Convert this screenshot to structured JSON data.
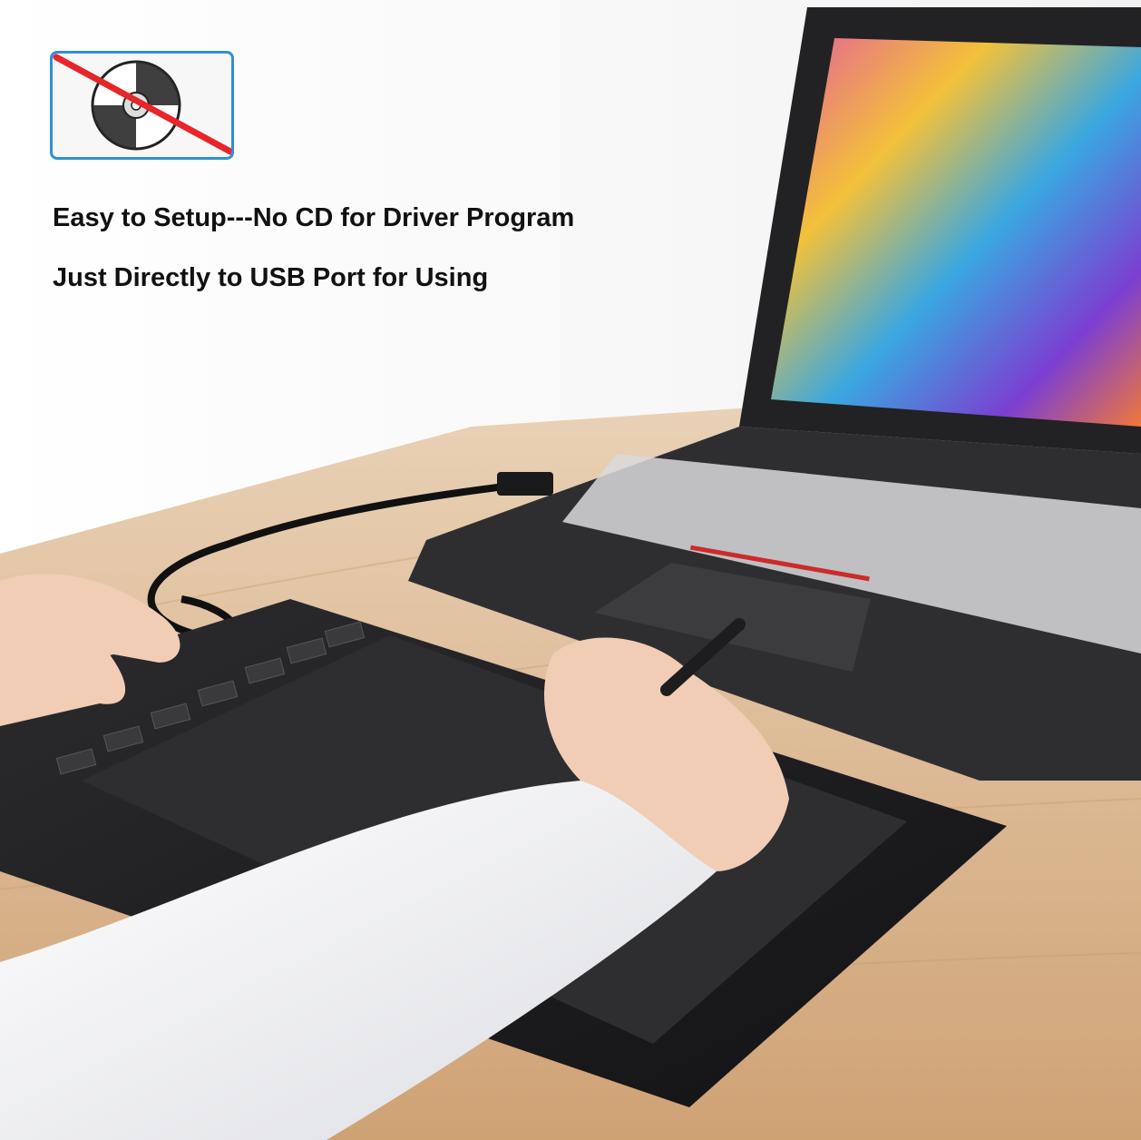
{
  "headline": {
    "line1": "Easy to Setup---No CD for Driver Program",
    "line2": "Just Directly to USB Port for Using"
  },
  "badge": {
    "icon": "no-cd-icon",
    "border_color": "#2f8fd8",
    "strike_color": "#e8252a"
  },
  "colors": {
    "desk": "#d8b48e",
    "tablet": "#1c1c1e",
    "laptop": "#2a2a2c"
  }
}
